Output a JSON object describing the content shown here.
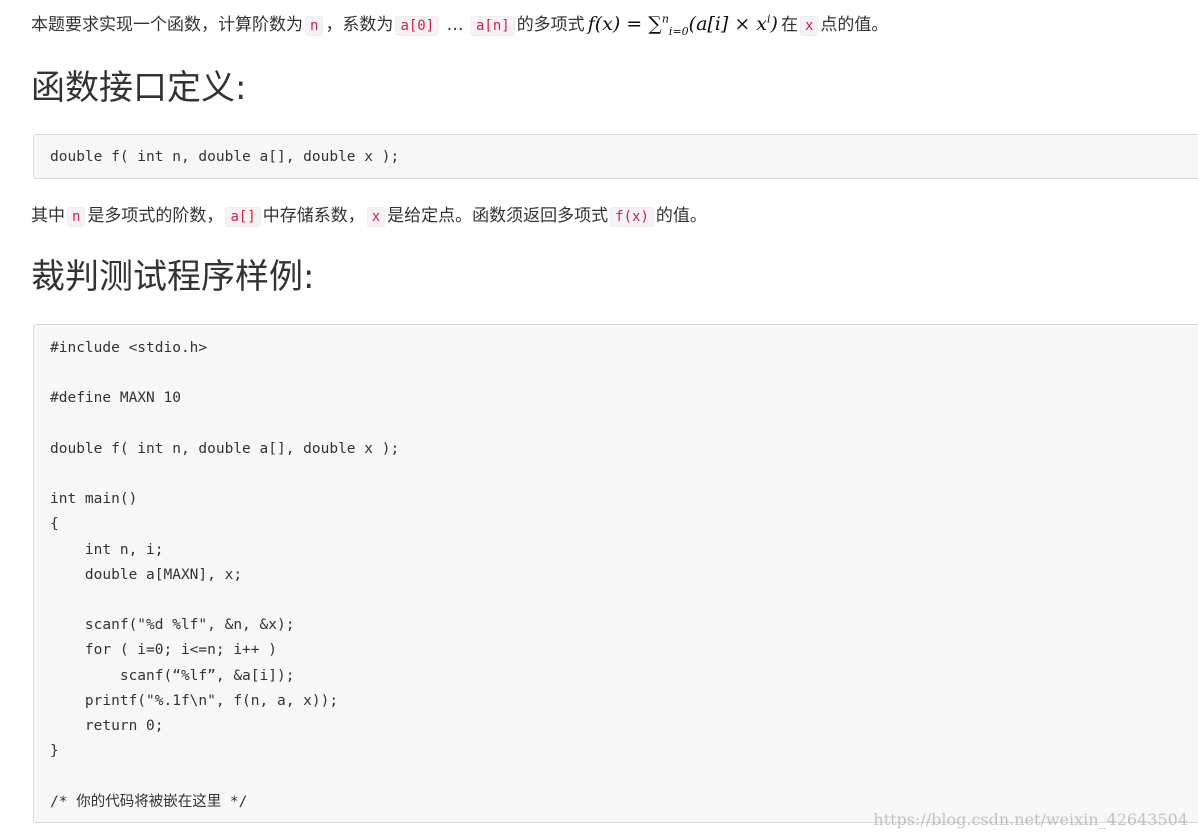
{
  "intro": {
    "text_before_n": "本题要求实现一个函数，计算阶数为",
    "code_n": "n",
    "text_coeff": "，系数为",
    "code_a0": "a[0]",
    "ellipsis": "…",
    "code_an": "a[n]",
    "text_poly": "的多项式",
    "formula_lhs": "f(x) = ∑",
    "formula_sup_n": "n",
    "formula_sub_i0": "i=0",
    "formula_body": "(a[i] × x",
    "formula_sup_i": "i",
    "formula_close": ")",
    "text_at": "在",
    "code_x": "x",
    "text_value": "点的值。"
  },
  "interface_section": {
    "heading": "函数接口定义:",
    "code": "double f( int n, double a[], double x );"
  },
  "description": {
    "text_where": "其中",
    "code_n": "n",
    "text_is_degree": "是多项式的阶数，",
    "code_a": "a[]",
    "text_stores": "中存储系数，",
    "code_x": "x",
    "text_given": "是给定点。函数须返回多项式",
    "code_fx": "f(x)",
    "text_value": "的值。"
  },
  "test_section": {
    "heading": "裁判测试程序样例:",
    "code": "#include <stdio.h>\n\n#define MAXN 10\n\ndouble f( int n, double a[], double x );\n\nint main()\n{\n    int n, i;\n    double a[MAXN], x;\n\n    scanf(\"%d %lf\", &n, &x);\n    for ( i=0; i<=n; i++ )\n        scanf(“%lf”, &a[i]);\n    printf(\"%.1f\\n\", f(n, a, x));\n    return 0;\n}\n\n/* 你的代码将被嵌在这里 */"
  },
  "watermark": "https://blog.csdn.net/weixin_42643504"
}
